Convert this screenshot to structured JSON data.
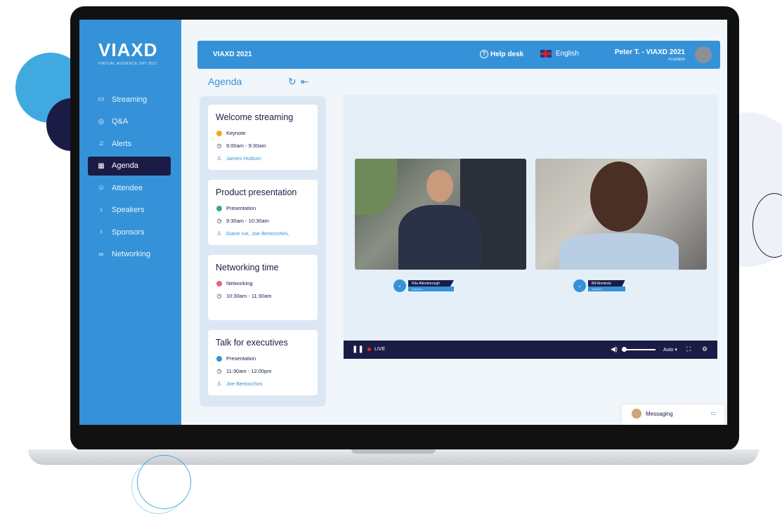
{
  "brand": {
    "name": "VIAXD",
    "tagline": "VIRTUAL AUDIENCE DAY 2021"
  },
  "sidebar": {
    "items": [
      {
        "label": "Streaming",
        "icon": "camera-icon"
      },
      {
        "label": "Q&A",
        "icon": "chat-icon"
      },
      {
        "label": "Alerts",
        "icon": "bell-icon"
      },
      {
        "label": "Agenda",
        "icon": "calendar-icon",
        "active": true
      },
      {
        "label": "Attendee",
        "icon": "people-icon"
      },
      {
        "label": "Speakers",
        "icon": "microphone-icon"
      },
      {
        "label": "Sponsors",
        "icon": "award-icon"
      },
      {
        "label": "Networking",
        "icon": "link-icon"
      }
    ]
  },
  "topbar": {
    "title": "VIAXD 2021",
    "help": "Help desk",
    "language": "English",
    "user": "Peter T. - VIAXD 2021",
    "status": "Available"
  },
  "agenda": {
    "title": "Agenda",
    "sessions": [
      {
        "title": "Welcome streaming",
        "type": "Keynote",
        "type_color": "#f5a623",
        "time": "9:00am - 9:30am",
        "speakers": "James Hudson"
      },
      {
        "title": "Product presentation",
        "type": "Presentation",
        "type_color": "#2fae78",
        "time": "9:30am - 10:30am",
        "speakers": "Diane Ive, Joe Bertocchini,"
      },
      {
        "title": "Networking time",
        "type": "Networking",
        "type_color": "#e8637a",
        "time": "10:30am - 11:30am",
        "speakers": ""
      },
      {
        "title": "Talk for executives",
        "type": "Presentation",
        "type_color": "#3592d8",
        "time": "11:30am - 12:00pm",
        "speakers": "Joe Bertocchini"
      }
    ]
  },
  "videos": [
    {
      "name": "Rita Attenborough",
      "role": "Speaker"
    },
    {
      "name": "Bill Alonteda",
      "role": "Speaker"
    }
  ],
  "player": {
    "live": "LIVE",
    "quality": "Auto ▾"
  },
  "messaging": {
    "label": "Messaging"
  },
  "colors": {
    "primary": "#3592d8",
    "navy": "#1b1c46",
    "background": "#f1f6fb"
  }
}
